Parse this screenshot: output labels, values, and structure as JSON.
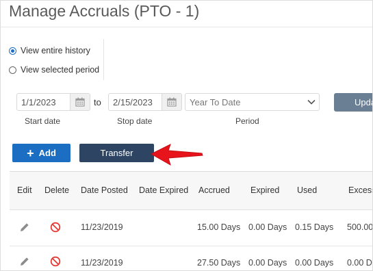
{
  "header": {
    "title": "Manage Accruals (PTO - 1)"
  },
  "history": {
    "options": [
      {
        "label": "View entire history",
        "selected": true
      },
      {
        "label": "View selected period",
        "selected": false
      }
    ]
  },
  "filters": {
    "start_date": "1/1/2023",
    "to_label": "to",
    "stop_date": "2/15/2023",
    "period": "Year To Date",
    "start_label": "Start date",
    "stop_label": "Stop date",
    "period_label": "Period",
    "update_label": "Upda"
  },
  "actions": {
    "add_label": "Add",
    "transfer_label": "Transfer"
  },
  "colors": {
    "accent": "#1b6ec2",
    "transfer": "#2d4563",
    "annotation_arrow": "#e8141c",
    "delete_icon": "#e53935"
  },
  "icons": {
    "edit": "pencil-icon",
    "delete": "prohibited-icon",
    "calendar": "calendar-icon",
    "period": "chevron-down-icon",
    "add": "plus-icon"
  },
  "table": {
    "columns": [
      "Edit",
      "Delete",
      "Date Posted",
      "Date Expired",
      "Accrued",
      "Expired",
      "Used",
      "Excess"
    ],
    "rows": [
      {
        "date_posted": "11/23/2019",
        "date_expired": "",
        "accrued": "15.00 Days",
        "expired": "0.00 Days",
        "used": "0.15 Days",
        "excess": "500.00"
      },
      {
        "date_posted": "11/23/2019",
        "date_expired": "",
        "accrued": "27.50 Days",
        "expired": "0.00 Days",
        "used": "0.00 Days",
        "excess": "0.00 Da"
      }
    ]
  }
}
